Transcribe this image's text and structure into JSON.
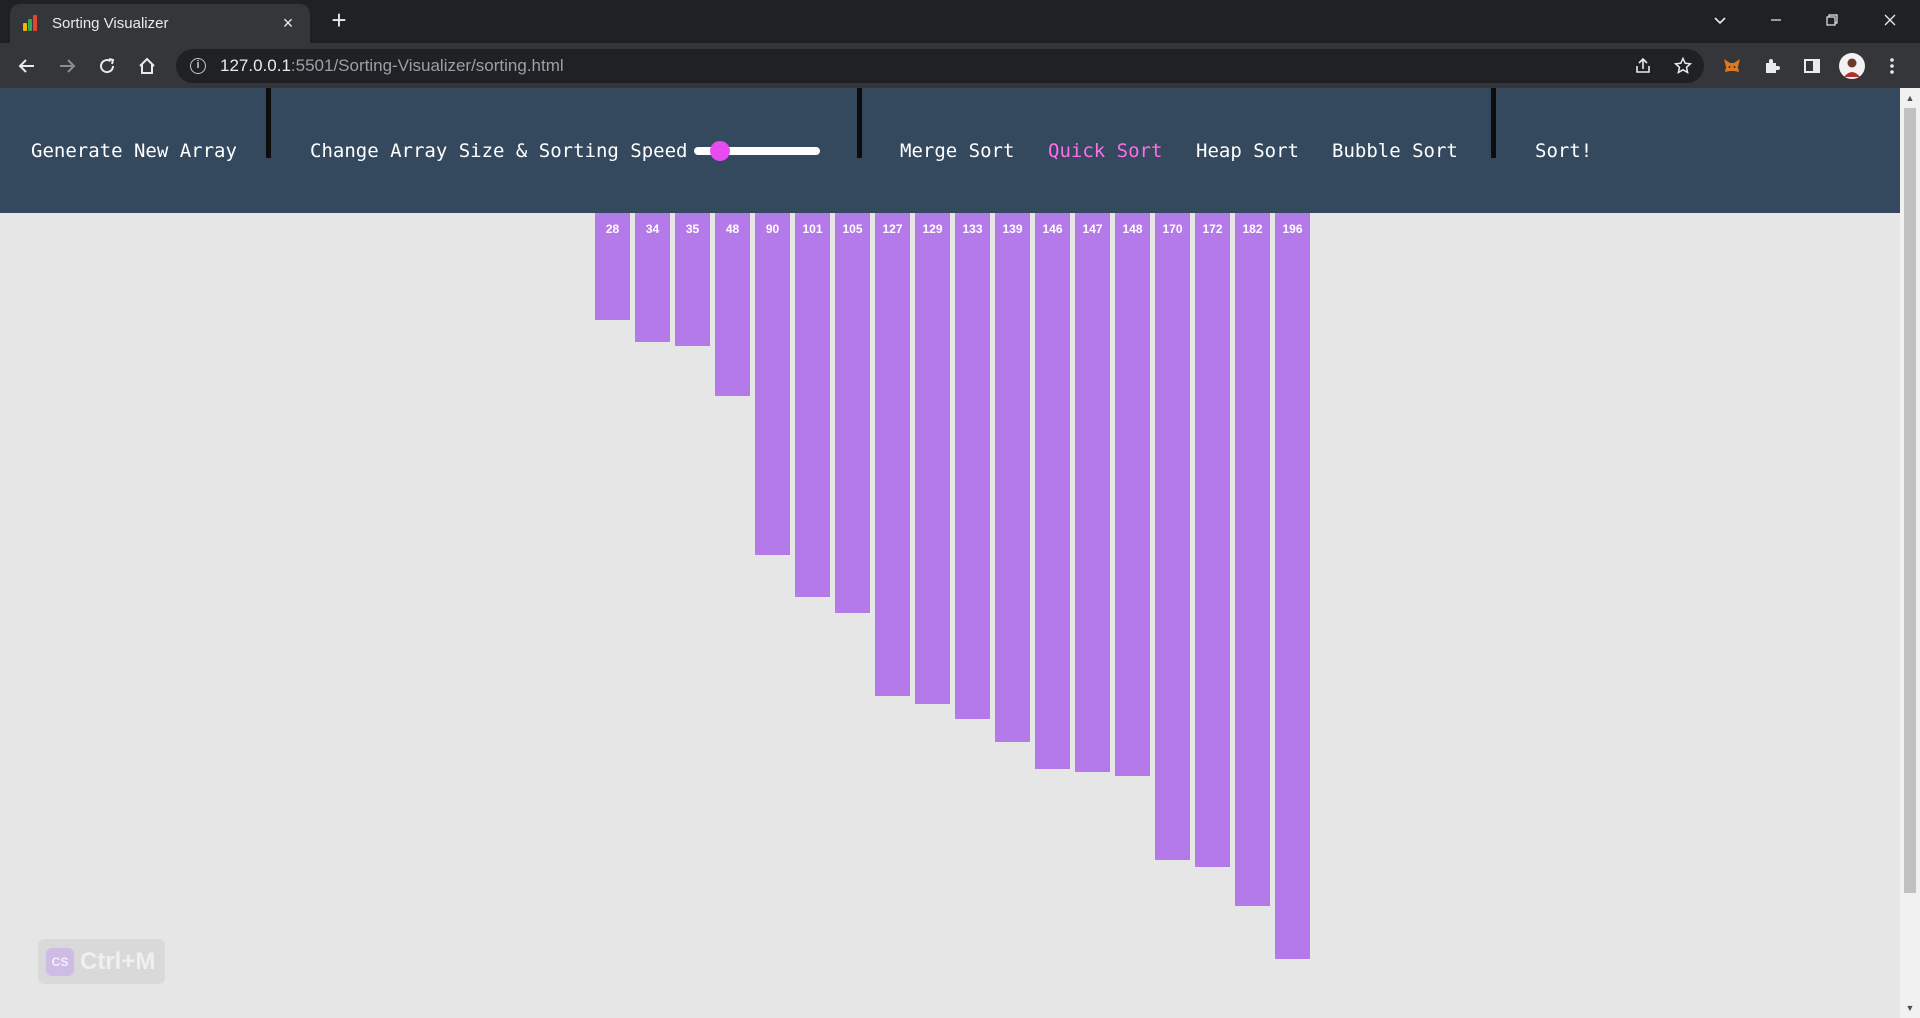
{
  "browser": {
    "tab_title": "Sorting Visualizer",
    "tab_close": "×",
    "new_tab": "+",
    "url_host": "127.0.0.1",
    "url_rest": ":5501/Sorting-Visualizer/sorting.html"
  },
  "navbar": {
    "generate": "Generate New Array",
    "change_size": "Change Array Size & Sorting Speed",
    "slider_level": 0.15,
    "algorithms": [
      "Merge Sort",
      "Quick Sort",
      "Heap Sort",
      "Bubble Sort"
    ],
    "active_algorithm": "Quick Sort",
    "sort_button": "Sort!"
  },
  "array": {
    "values": [
      28,
      34,
      35,
      48,
      90,
      101,
      105,
      127,
      129,
      133,
      139,
      146,
      147,
      148,
      170,
      172,
      182,
      196
    ],
    "bar_color": "#b57aea"
  },
  "colors": {
    "navbar_bg": "#34495e",
    "active_link": "#ff6ee9",
    "slider_thumb": "#e64cf2",
    "page_bg": "#e6e6e6"
  },
  "extension_badge": {
    "icon": "CS",
    "text": "Ctrl+M"
  }
}
